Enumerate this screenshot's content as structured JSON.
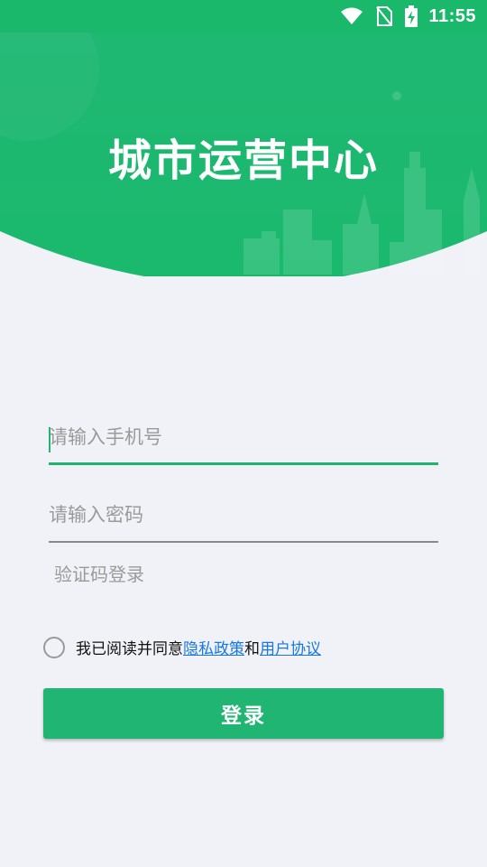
{
  "status_bar": {
    "time": "11:55",
    "icons": [
      "wifi-icon",
      "no-sim-icon",
      "battery-charging-icon"
    ]
  },
  "header": {
    "title": "城市运营中心",
    "background_color": "#19b86a"
  },
  "form": {
    "phone_placeholder": "请输入手机号",
    "password_placeholder": "请输入密码",
    "sms_login_label": "验证码登录"
  },
  "agreement": {
    "prefix": "我已阅读并同意",
    "privacy_link": "隐私政策",
    "conjunction": "和",
    "terms_link": "用户协议",
    "checked": false
  },
  "login_button": {
    "label": "登录",
    "color": "#21b573"
  },
  "colors": {
    "accent": "#21b36f",
    "link": "#1677e8",
    "page_background": "#f0f2f7"
  }
}
